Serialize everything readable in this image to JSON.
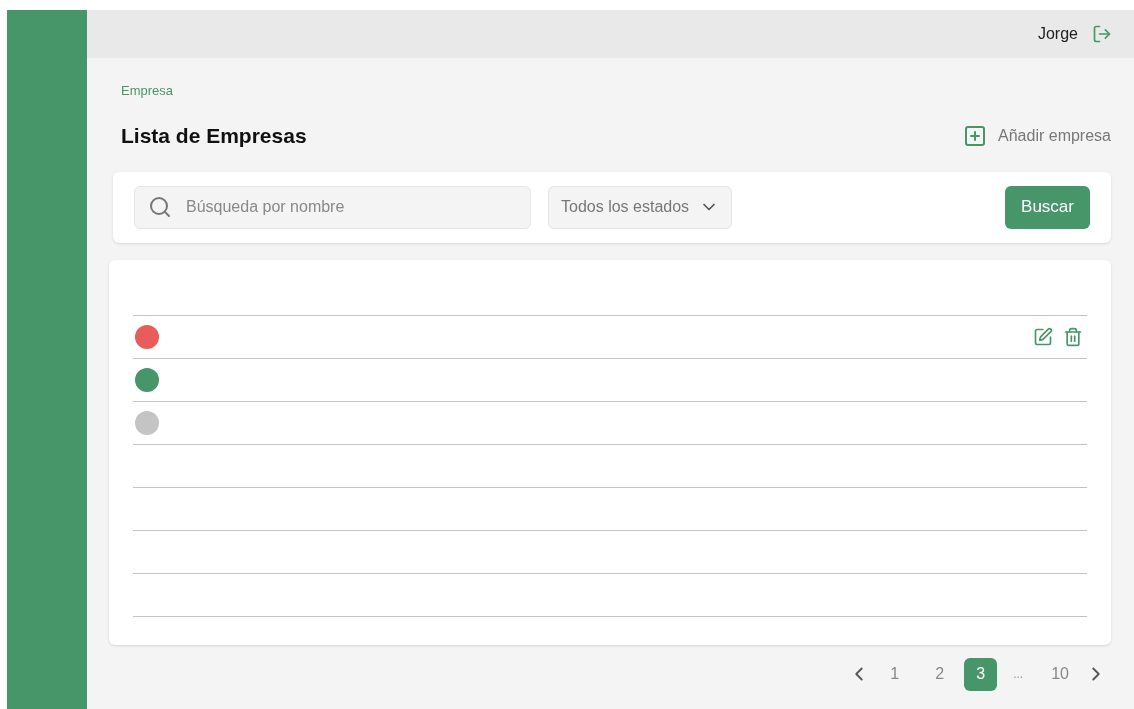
{
  "header": {
    "user_name": "Jorge"
  },
  "breadcrumb": "Empresa",
  "title": "Lista de Empresas",
  "add_button": "Añadir empresa",
  "filters": {
    "search": {
      "placeholder": "Búsqueda por nombre"
    },
    "status_select": "Todos los estados",
    "search_button": "Buscar"
  },
  "table": {
    "rows": [
      {
        "color": "#e85c5a",
        "actions_visible": true
      },
      {
        "color": "#47966a",
        "actions_visible": false
      },
      {
        "color": "#c4c4c4",
        "actions_visible": false
      },
      {
        "actions_visible": false
      },
      {
        "actions_visible": false
      },
      {
        "actions_visible": false
      },
      {
        "actions_visible": false
      }
    ]
  },
  "pagination": {
    "pages": [
      {
        "kind": "page",
        "label": "1",
        "selected": false
      },
      {
        "kind": "page",
        "label": "2",
        "selected": false
      },
      {
        "kind": "page",
        "label": "3",
        "selected": true
      },
      {
        "kind": "ellipsis",
        "label": "..."
      },
      {
        "kind": "page",
        "label": "10",
        "selected": false
      }
    ]
  }
}
